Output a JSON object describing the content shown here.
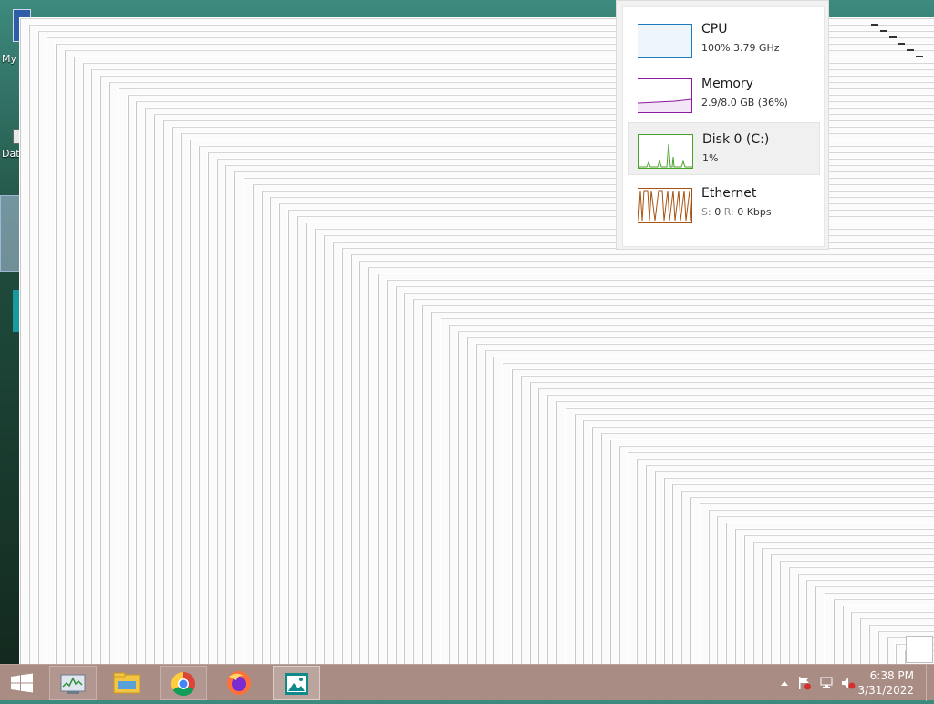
{
  "desktop": {
    "icons": [
      {
        "label": "My"
      },
      {
        "label": "Dat"
      },
      {
        "label": ""
      },
      {
        "label": ""
      }
    ]
  },
  "perf_popup": {
    "items": [
      {
        "title": "CPU",
        "detail": "100%  3.79 GHz",
        "color": "#1f7bbf",
        "selected": false
      },
      {
        "title": "Memory",
        "detail": "2.9/8.0 GB (36%)",
        "color": "#8b1a9e",
        "selected": false
      },
      {
        "title": "Disk 0 (C:)",
        "detail": "1%",
        "color": "#4aa12a",
        "selected": true
      },
      {
        "title": "Ethernet",
        "detail_s_label": "S:",
        "detail_s_value": "0",
        "detail_r_label": "R:",
        "detail_r_value": "0 Kbps",
        "color": "#a65212",
        "selected": false
      }
    ]
  },
  "taskbar": {
    "start_icon": "windows-logo-icon",
    "apps": [
      {
        "name": "task-manager-icon",
        "state": "running"
      },
      {
        "name": "file-explorer-icon",
        "state": "normal"
      },
      {
        "name": "chrome-icon",
        "state": "running"
      },
      {
        "name": "firefox-icon",
        "state": "normal"
      },
      {
        "name": "photos-icon",
        "state": "active"
      }
    ],
    "tray": [
      "show-hidden-icons-icon",
      "action-center-flag-icon",
      "network-icon",
      "volume-muted-icon"
    ],
    "time": "6:38 PM",
    "date": "3/31/2022"
  },
  "colors": {
    "taskbar": "#a98c84",
    "window_bg": "#fbfbfb"
  }
}
